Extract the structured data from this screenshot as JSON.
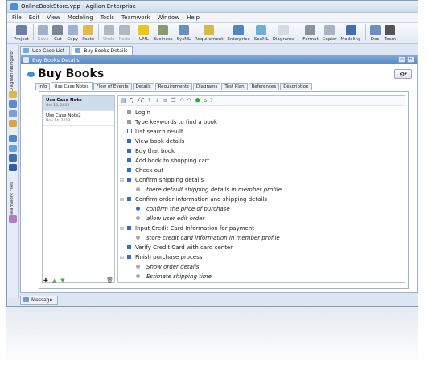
{
  "window": {
    "title": "OnlineBookStore.vpp - Agilian Enterprise"
  },
  "menu": [
    "File",
    "Edit",
    "View",
    "Modeling",
    "Tools",
    "Teamwork",
    "Window",
    "Help"
  ],
  "toolbar": [
    {
      "label": "Project",
      "icon": "project-icon",
      "color": "#6d7fa3",
      "dim": false
    },
    {
      "sep": true
    },
    {
      "label": "Save",
      "icon": "save-icon",
      "color": "#9fb0c8",
      "dim": true
    },
    {
      "label": "Cut",
      "icon": "cut-icon",
      "color": "#7b8796",
      "dim": false
    },
    {
      "label": "Copy",
      "icon": "copy-icon",
      "color": "#9cb3d6",
      "dim": false
    },
    {
      "label": "Paste",
      "icon": "paste-icon",
      "color": "#e6b94d",
      "dim": false
    },
    {
      "sep": true
    },
    {
      "label": "Undo",
      "icon": "undo-icon",
      "color": "#b0b8c4",
      "dim": true
    },
    {
      "label": "Redo",
      "icon": "redo-icon",
      "color": "#b0b8c4",
      "dim": true
    },
    {
      "sep": true
    },
    {
      "label": "UML",
      "icon": "uml-icon",
      "color": "#f0c419",
      "dim": false
    },
    {
      "label": "Business",
      "icon": "business-icon",
      "color": "#8a9a6a",
      "dim": false
    },
    {
      "label": "SysML",
      "icon": "sysml-icon",
      "color": "#6a8fb8",
      "dim": false
    },
    {
      "label": "Requirement",
      "icon": "requirement-icon",
      "color": "#d8b84a",
      "dim": false
    },
    {
      "label": "Enterprise",
      "icon": "enterprise-icon",
      "color": "#4f86c6",
      "dim": false
    },
    {
      "label": "SoaML",
      "icon": "soaml-icon",
      "color": "#6bb0d9",
      "dim": false
    },
    {
      "label": "Diagrams",
      "icon": "diagrams-icon",
      "color": "#d6dbe3",
      "dim": false
    },
    {
      "sep": true
    },
    {
      "label": "Format",
      "icon": "format-icon",
      "color": "#8d939c",
      "dim": false
    },
    {
      "label": "Copier",
      "icon": "copier-icon",
      "color": "#a9b3c1",
      "dim": false
    },
    {
      "label": "Modeling",
      "icon": "modeling-icon",
      "color": "#3f6fb0",
      "dim": false
    },
    {
      "sep": true
    },
    {
      "label": "Doc",
      "icon": "doc-icon",
      "color": "#6d8fbf",
      "dim": false
    },
    {
      "label": "Team",
      "icon": "team-icon",
      "color": "#555555",
      "dim": false
    }
  ],
  "leftstrip": {
    "top_label": "Diagram Navigator",
    "bottom_label": "Teamwork Files"
  },
  "doc_tabs": [
    "Use Case List",
    "Buy Books Details"
  ],
  "panel": {
    "header": "Buy Books Details",
    "title": "Buy Books",
    "tabs": [
      "Info",
      "Use Case Notes",
      "Flow of Events",
      "Details",
      "Requirements",
      "Diagrams",
      "Test Plan",
      "References",
      "Description"
    ],
    "active_tab": 1
  },
  "notes": [
    {
      "title": "Use Case Note",
      "date": "Oct 18, 2013",
      "selected": true
    },
    {
      "title": "Use Case Note2",
      "date": "Nov 14, 2013",
      "selected": false
    }
  ],
  "editor_lines": [
    {
      "text": "Login",
      "level": 1,
      "bullet": "square-gray",
      "collapse": ""
    },
    {
      "text": "Type keywords to find a book",
      "level": 1,
      "bullet": "square-gray",
      "collapse": ""
    },
    {
      "text": "List search result",
      "level": 1,
      "bullet": "square-outline",
      "collapse": ""
    },
    {
      "text": "View book details",
      "level": 1,
      "bullet": "square",
      "collapse": ""
    },
    {
      "text": "Buy that book",
      "level": 1,
      "bullet": "square",
      "collapse": ""
    },
    {
      "text": "Add book to shopping cart",
      "level": 1,
      "bullet": "square",
      "collapse": ""
    },
    {
      "text": "Check out",
      "level": 1,
      "bullet": "square",
      "collapse": ""
    },
    {
      "text": "Confirm shipping details",
      "level": 1,
      "bullet": "square",
      "collapse": "⊟"
    },
    {
      "text": "there default shipping details in member profile",
      "level": 2,
      "bullet": "dot-gray",
      "collapse": ""
    },
    {
      "text": "Confirm order information and shipping details",
      "level": 1,
      "bullet": "square",
      "collapse": "⊟"
    },
    {
      "text": "confirm the price of purchase",
      "level": 2,
      "bullet": "dot",
      "collapse": ""
    },
    {
      "text": "allow user edit order",
      "level": 2,
      "bullet": "dot-gray",
      "collapse": ""
    },
    {
      "text": "Input Credit Card Information for payment",
      "level": 1,
      "bullet": "square",
      "collapse": "⊟"
    },
    {
      "text": "store credit card information in member profile",
      "level": 2,
      "bullet": "dot-gray",
      "collapse": ""
    },
    {
      "text": "Verify Credit Card with card center",
      "level": 1,
      "bullet": "square",
      "collapse": ""
    },
    {
      "text": "Finish purchase process",
      "level": 1,
      "bullet": "square",
      "collapse": "⊟"
    },
    {
      "text": "Show order details",
      "level": 2,
      "bullet": "dot-gray",
      "collapse": ""
    },
    {
      "text": "Estimate shipping time",
      "level": 2,
      "bullet": "dot-gray",
      "collapse": ""
    }
  ],
  "status_tab": "Message"
}
